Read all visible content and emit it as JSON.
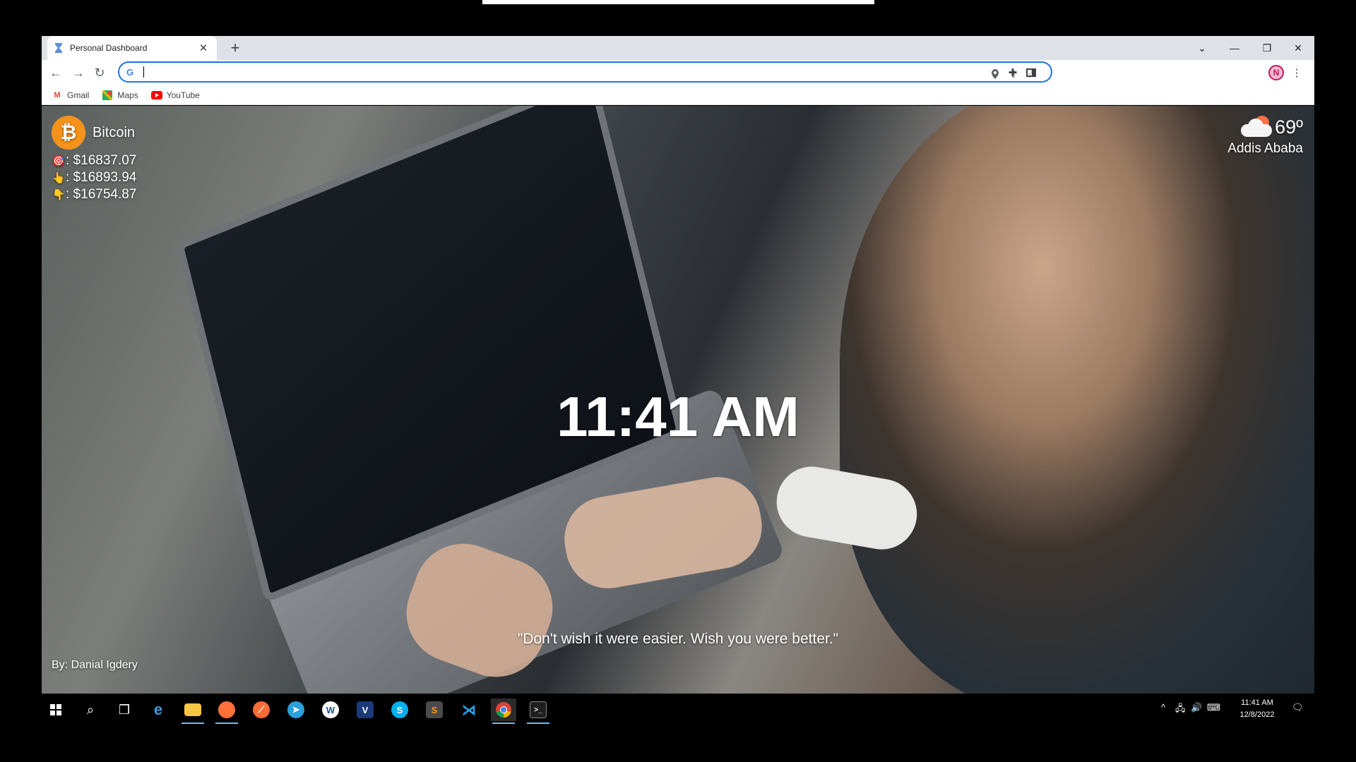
{
  "browser": {
    "tab_title": "Personal Dashboard",
    "tab_close": "✕",
    "new_tab": "+",
    "controls": {
      "dropdown": "⌄",
      "minimize": "—",
      "restore": "❐",
      "close": "✕"
    },
    "omnibox": {
      "value": "",
      "placeholder": ""
    },
    "bookmarks": [
      {
        "label": "Gmail",
        "icon": "gmail-icon",
        "color": "#ea4335"
      },
      {
        "label": "Maps",
        "icon": "maps-icon",
        "color": "#34a853"
      },
      {
        "label": "YouTube",
        "icon": "youtube-icon",
        "color": "#ff0000"
      }
    ],
    "profile_initial": "N"
  },
  "dashboard": {
    "crypto": {
      "name": "Bitcoin",
      "symbol_glyph": "₿",
      "current": ": $16837.07",
      "high": ": $16893.94",
      "low": ": $16754.87"
    },
    "weather": {
      "temperature": "69º",
      "city": "Addis Ababa"
    },
    "time": "11:41 AM",
    "quote": "\"Don't wish it were easier. Wish you were better.\"",
    "author": "By: Danial Igdery"
  },
  "taskbar": {
    "apps": [
      "start",
      "search",
      "task-view",
      "edge",
      "file-explorer",
      "firefox",
      "postman",
      "telegram",
      "app-w",
      "vyprvpn",
      "skype",
      "sublime-text",
      "vscode",
      "chrome",
      "terminal"
    ],
    "time": "11:41 AM",
    "date": "12/8/2022"
  }
}
